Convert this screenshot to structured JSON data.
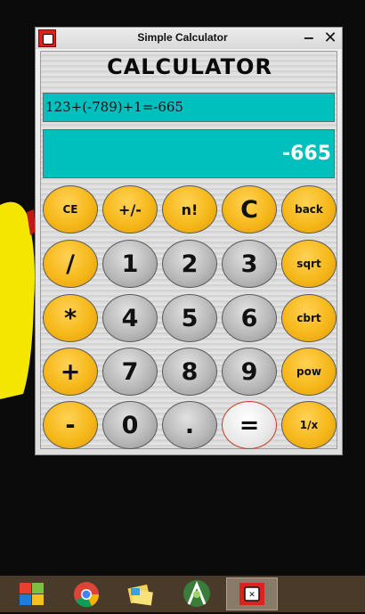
{
  "window": {
    "title": "Simple Calculator",
    "minimize_glyph": "−",
    "close_glyph": "✕"
  },
  "calculator": {
    "heading": "CALCULATOR",
    "expression": "123+(-789)+1=-665",
    "result": "-665"
  },
  "keys": [
    [
      "CE",
      "+/-",
      "n!",
      "C",
      "back"
    ],
    [
      "/",
      "1",
      "2",
      "3",
      "sqrt"
    ],
    [
      "*",
      "4",
      "5",
      "6",
      "cbrt"
    ],
    [
      "+",
      "7",
      "8",
      "9",
      "pow"
    ],
    [
      "-",
      "0",
      ".",
      "=",
      "1/x"
    ]
  ],
  "colors": {
    "display": "#00c0bd",
    "orange_key": "#f6b81a",
    "gray_key": "#b9b9b9",
    "result_text": "#ffffff",
    "app_icon": "#d9231c"
  },
  "taskbar": {
    "items": [
      {
        "icon": "windows-start-icon"
      },
      {
        "icon": "chrome-icon"
      },
      {
        "icon": "file-explorer-icon"
      },
      {
        "icon": "android-studio-icon"
      },
      {
        "icon": "calculator-app-icon",
        "active": true
      }
    ]
  }
}
